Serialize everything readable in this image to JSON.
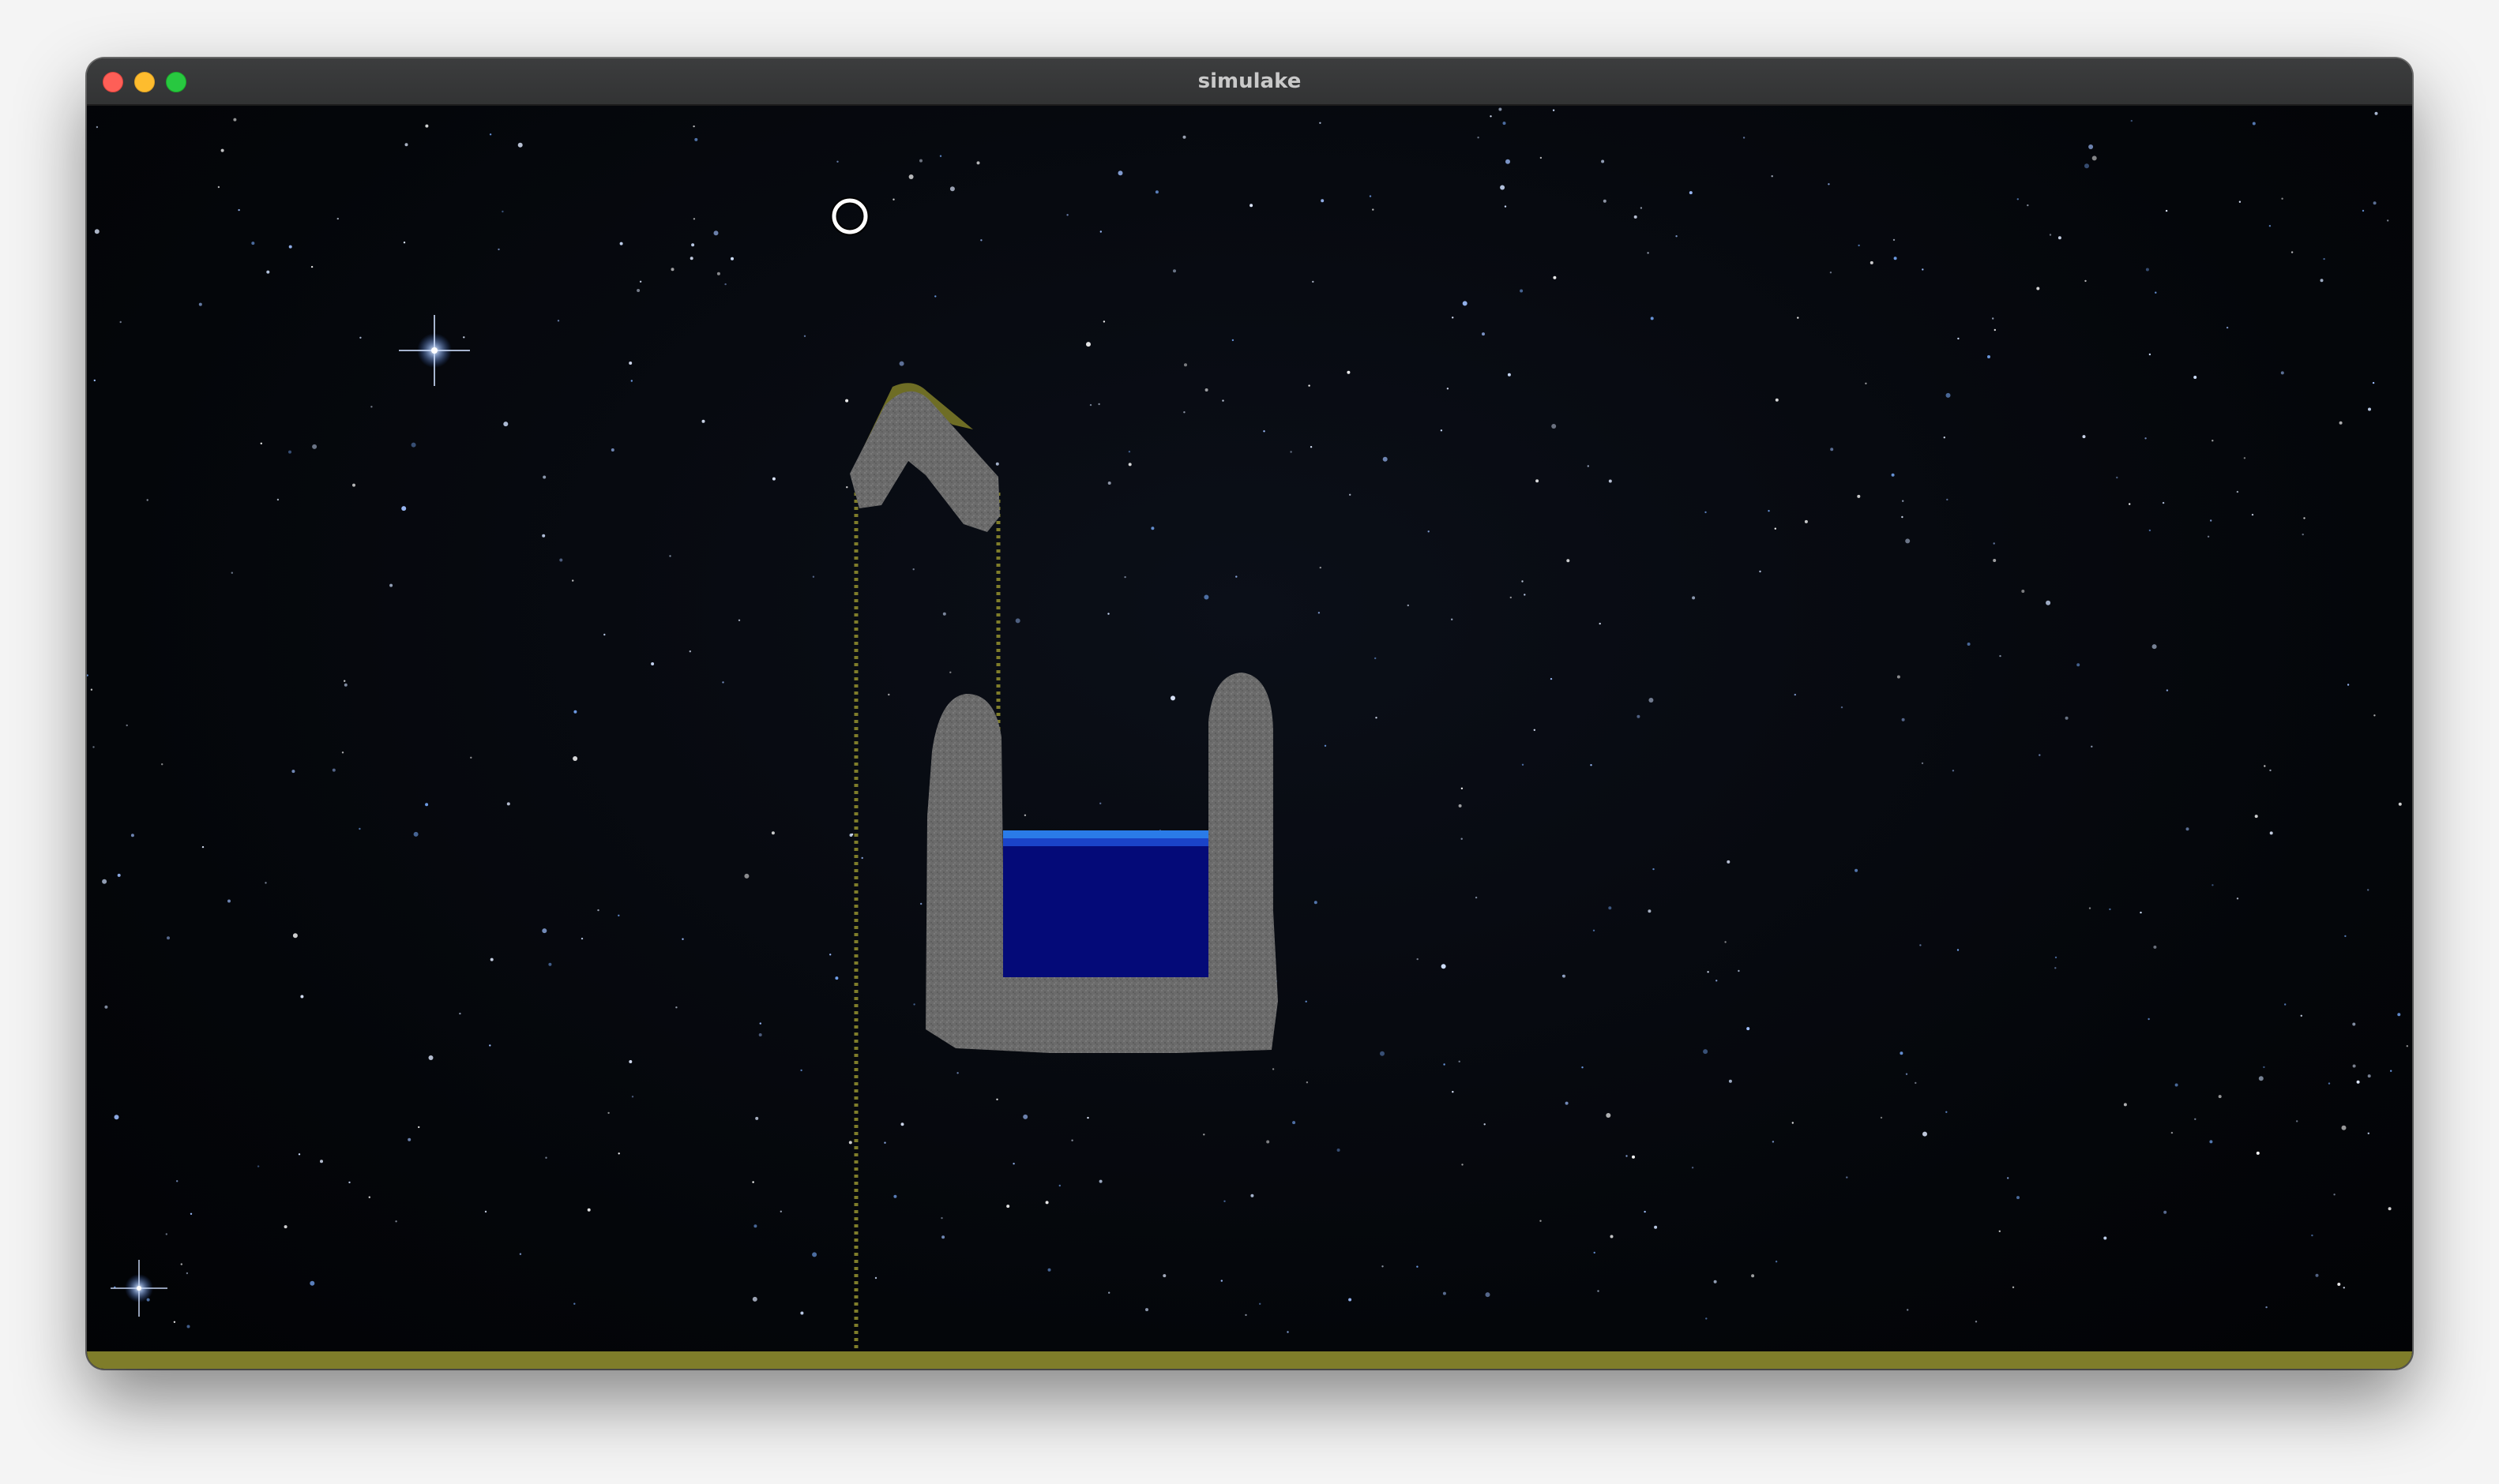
{
  "window": {
    "title": "simulake"
  },
  "icons": {
    "close": "close-traffic-light",
    "minimize": "minimize-traffic-light",
    "maximize": "maximize-traffic-light",
    "cursor": "brush-cursor-icon"
  },
  "colors": {
    "space_background": "#03050a",
    "stone": "#6d6d6d",
    "sand": "#8c8a2e",
    "water_deep": "#040a7a",
    "water_surface": "#1e63d8",
    "star": "#ffffff"
  }
}
